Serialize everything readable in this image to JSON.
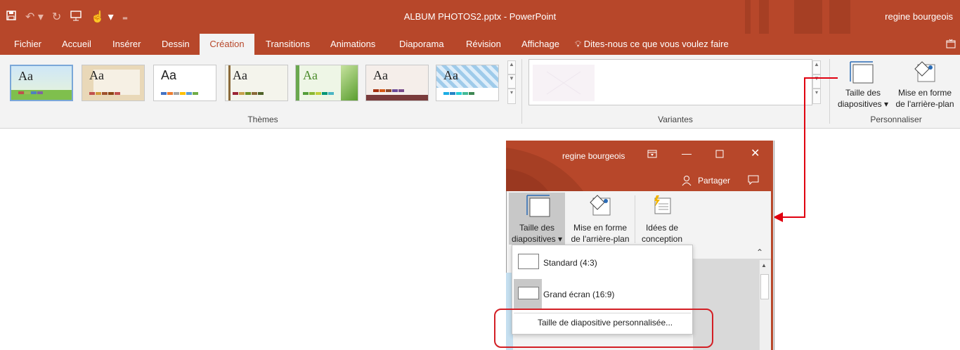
{
  "titlebar": {
    "doc_title": "ALBUM PHOTOS2.pptx - PowerPoint",
    "user": "regine bourgeois",
    "qat": [
      "save-icon",
      "undo-icon",
      "redo-icon",
      "slideshow-icon",
      "touch-icon",
      "customize-icon"
    ]
  },
  "tabs": [
    "Fichier",
    "Accueil",
    "Insérer",
    "Dessin",
    "Création",
    "Transitions",
    "Animations",
    "Diaporama",
    "Révision",
    "Affichage"
  ],
  "active_tab": "Création",
  "search": "Dites-nous ce que vous voulez faire",
  "ribbon": {
    "themes_label": "Thèmes",
    "variants_label": "Variantes",
    "customize_label": "Personnaliser",
    "slide_size_line1": "Taille des",
    "slide_size_line2": "diapositives ▾",
    "bg_format_line1": "Mise en forme",
    "bg_format_line2": "de l'arrière-plan",
    "themes": [
      {
        "sample": "Aa",
        "bg": "#e8f4d8"
      },
      {
        "sample": "Aa",
        "bg": "#f6f0e4"
      },
      {
        "sample": "Aa",
        "bg": "#ffffff"
      },
      {
        "sample": "Aa",
        "bg": "#f4f4ec"
      },
      {
        "sample": "Aa",
        "bg": "#eef6e6"
      },
      {
        "sample": "Aa",
        "bg": "#f5eeea"
      },
      {
        "sample": "Aa",
        "bg": "#dfeefa"
      }
    ]
  },
  "overlay": {
    "user": "regine bourgeois",
    "share": "Partager",
    "slide_size_line1": "Taille des",
    "slide_size_line2": "diapositives ▾",
    "bg_format_line1": "Mise en forme",
    "bg_format_line2": "de l'arrière-plan",
    "ideas_line1": "Idées de",
    "ideas_line2": "conception",
    "dropdown": {
      "standard": "Standard (4:3)",
      "widescreen": "Grand écran (16:9)",
      "custom": "Taille de diapositive personnalisée..."
    }
  },
  "colors": {
    "accent": "#b7472a",
    "highlight": "#d31f25",
    "arrow": "#e0000f"
  }
}
